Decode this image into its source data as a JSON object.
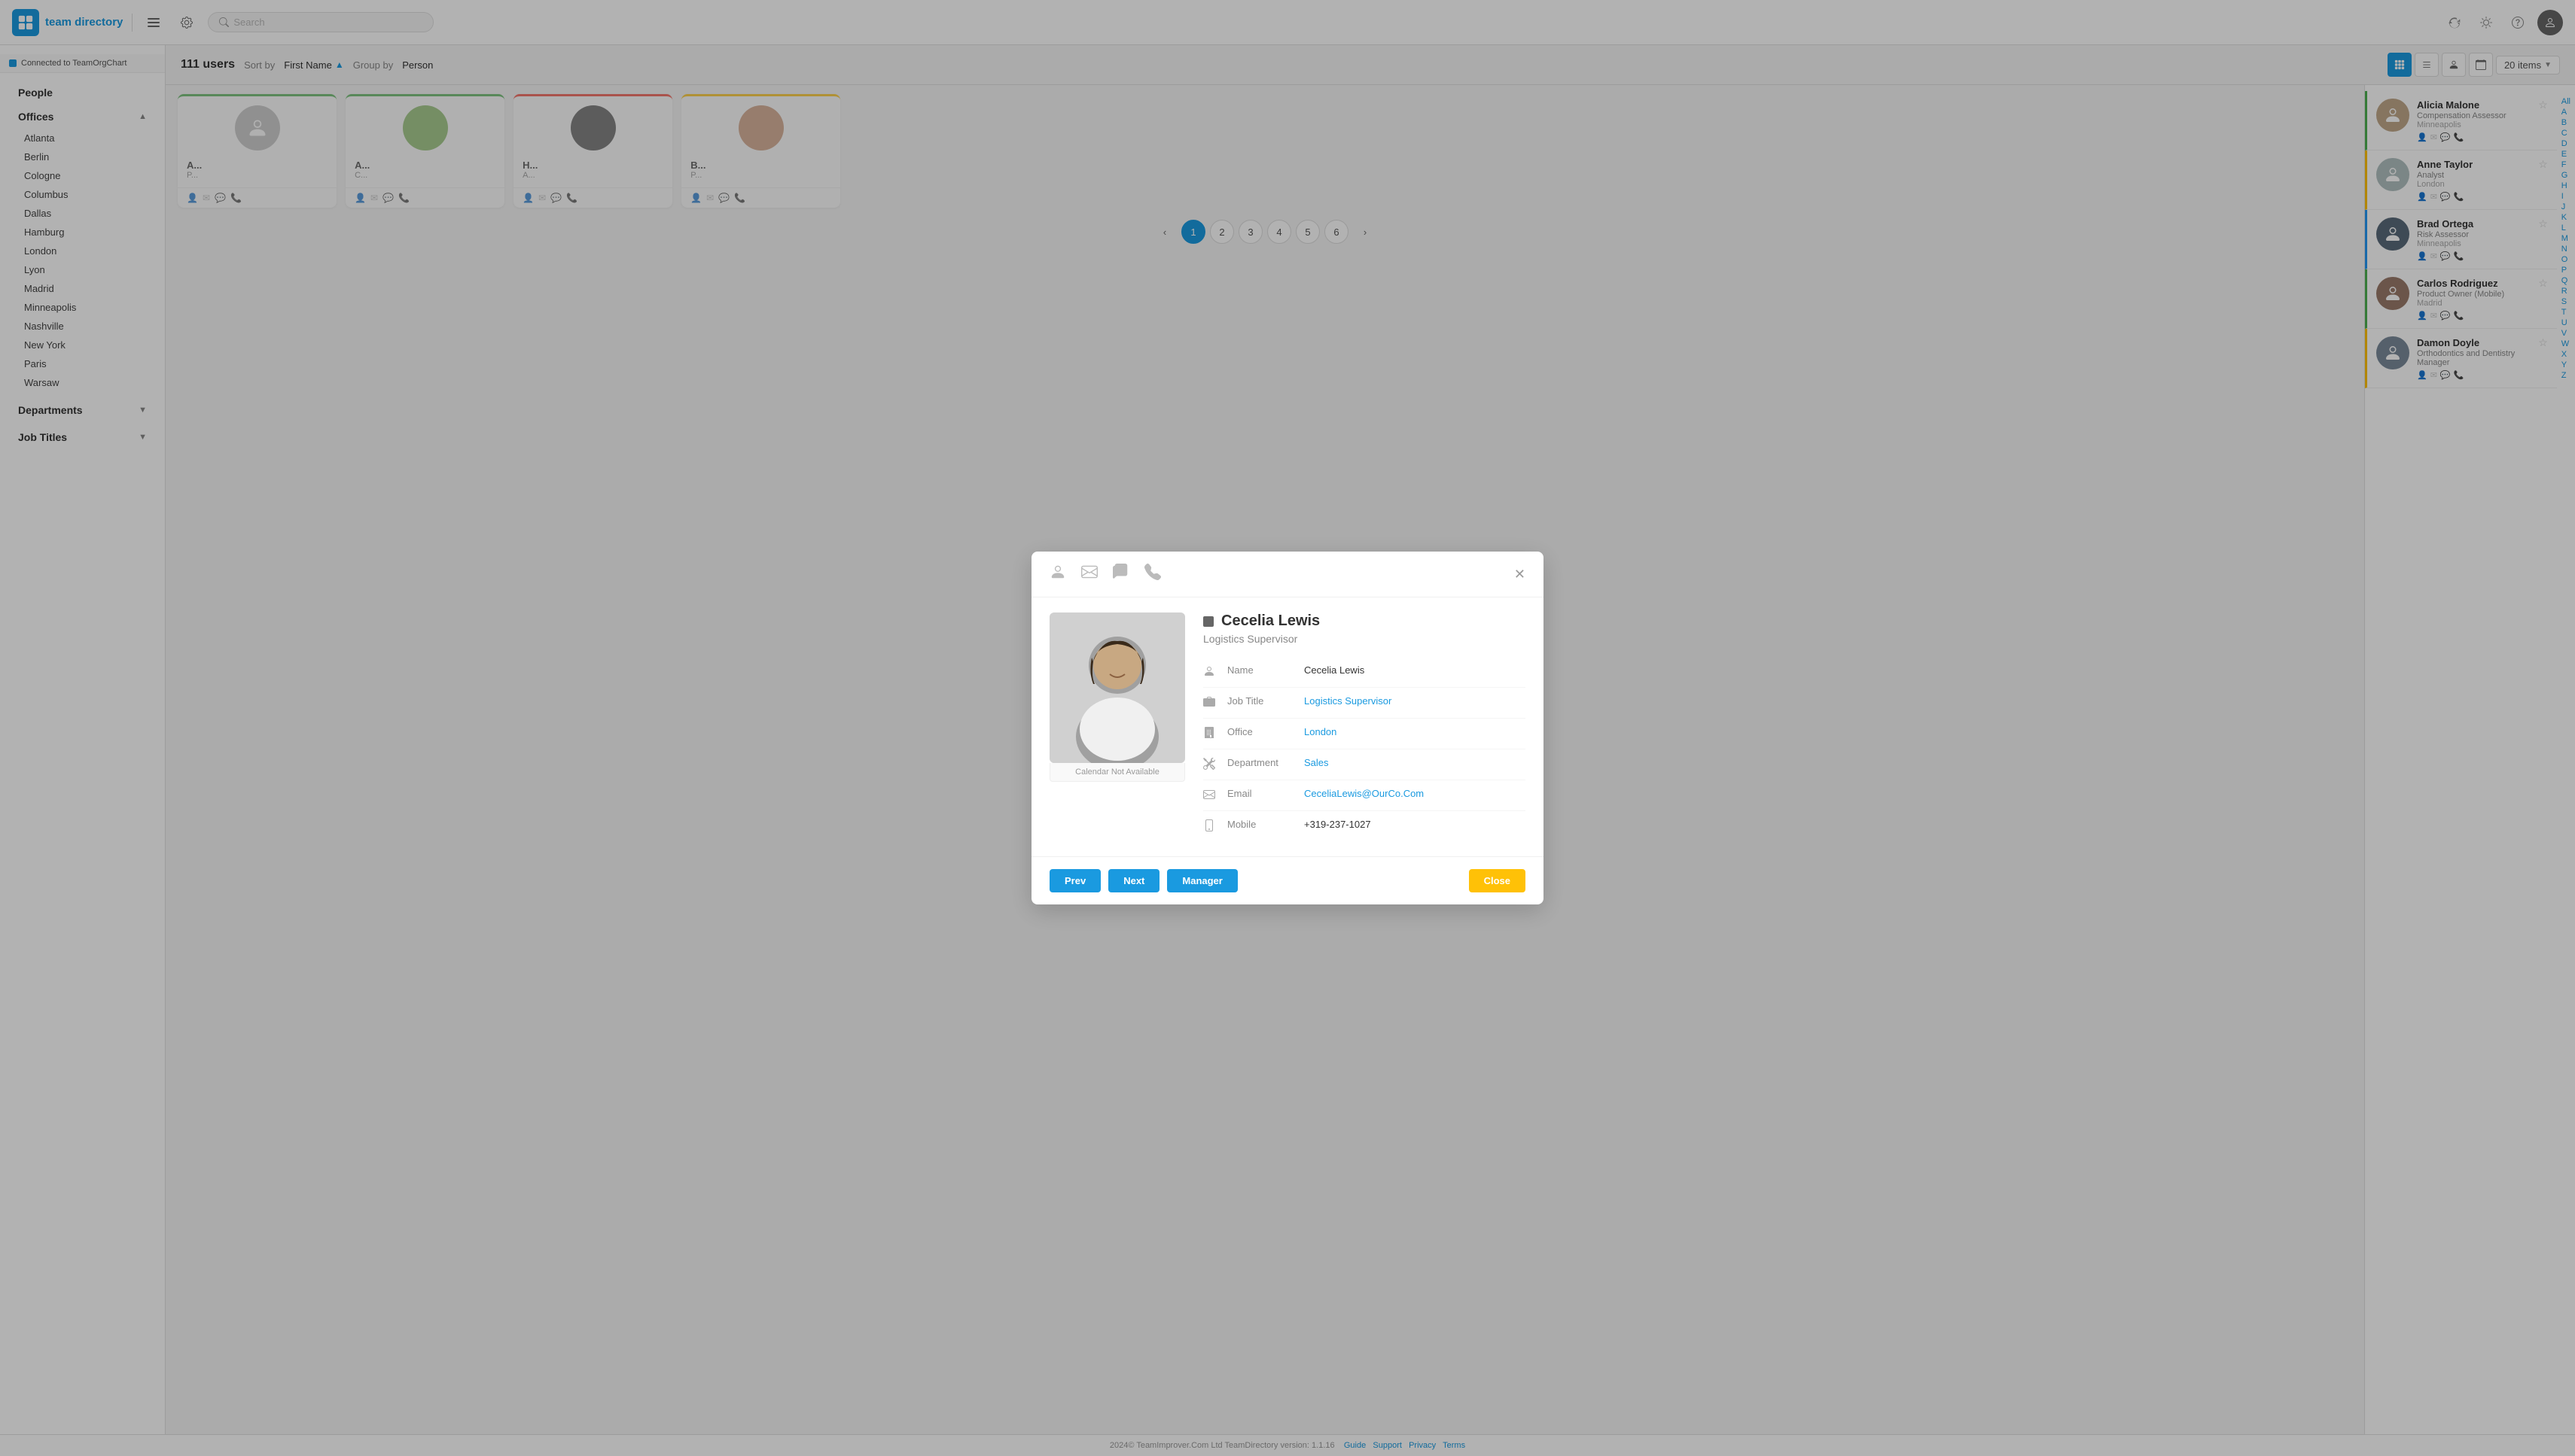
{
  "app": {
    "title": "team directory",
    "connected": "Connected to TeamOrgChart"
  },
  "topbar": {
    "search_placeholder": "Search",
    "refresh_title": "Refresh",
    "settings_title": "Settings",
    "help_title": "Help",
    "avatar_label": "User Avatar"
  },
  "sidebar": {
    "people_label": "People",
    "offices_label": "Offices",
    "offices_toggle": "▲",
    "offices": [
      "Atlanta",
      "Berlin",
      "Cologne",
      "Columbus",
      "Dallas",
      "Hamburg",
      "London",
      "Lyon",
      "Madrid",
      "Minneapolis",
      "Nashville",
      "New York",
      "Paris",
      "Warsaw"
    ],
    "departments_label": "Departments",
    "departments_toggle": "▼",
    "jobtitles_label": "Job Titles",
    "jobtitles_toggle": "▼"
  },
  "content_header": {
    "user_count": "111 users",
    "sort_by_label": "Sort by",
    "sort_by_value": "First Name",
    "group_by_label": "Group by",
    "group_by_value": "Person",
    "items_count": "20 items"
  },
  "right_panel": {
    "people": [
      {
        "name": "Alicia Malone",
        "role": "Compensation Assessor",
        "location": "Minneapolis",
        "border": "green"
      },
      {
        "name": "Anne Taylor",
        "role": "Analyst",
        "location": "London",
        "border": "yellow"
      },
      {
        "name": "Brad Ortega",
        "role": "Risk Assessor",
        "location": "Minneapolis",
        "border": "blue"
      },
      {
        "name": "Carlos Rodriguez",
        "role": "Product Owner (Mobile)",
        "location": "Madrid",
        "border": "green"
      },
      {
        "name": "Damon Doyle",
        "role": "Orthodontics and Dentistry Manager",
        "location": "",
        "border": "yellow"
      }
    ]
  },
  "alpha_index": [
    "All",
    "A",
    "B",
    "C",
    "D",
    "E",
    "F",
    "G",
    "H",
    "I",
    "J",
    "K",
    "L",
    "M",
    "N",
    "O",
    "P",
    "Q",
    "R",
    "S",
    "T",
    "U",
    "V",
    "W",
    "X",
    "Y",
    "Z"
  ],
  "pagination": {
    "pages": [
      "1",
      "2",
      "3",
      "4",
      "5",
      "6"
    ],
    "current": "1"
  },
  "modal": {
    "header_icons": {
      "person": "👤",
      "email": "✉",
      "chat": "💬",
      "phone": "📞"
    },
    "photo_caption": "Calendar Not Available",
    "name": "Cecelia Lewis",
    "job_title_display": "Logistics Supervisor",
    "fields": {
      "name_label": "Name",
      "name_value": "Cecelia Lewis",
      "jobtitle_label": "Job Title",
      "jobtitle_value": "Logistics Supervisor",
      "office_label": "Office",
      "office_value": "London",
      "department_label": "Department",
      "department_value": "Sales",
      "email_label": "Email",
      "email_value": "CeceliaLewis@OurCo.Com",
      "mobile_label": "Mobile",
      "mobile_value": "+319-237-1027"
    },
    "buttons": {
      "prev": "Prev",
      "next": "Next",
      "manager": "Manager",
      "close": "Close"
    }
  },
  "footer": {
    "copyright": "2024© TeamImprover.Com Ltd  TeamDirectory version: 1.1.16",
    "links": [
      "Guide",
      "Support",
      "Privacy",
      "Terms"
    ]
  },
  "cards": [
    {
      "name": "A",
      "role": "P",
      "border": "green"
    },
    {
      "name": "A",
      "role": "C",
      "border": "green"
    },
    {
      "name": "H",
      "role": "A",
      "border": "red"
    },
    {
      "name": "B",
      "role": "P",
      "border": "yellow"
    }
  ]
}
